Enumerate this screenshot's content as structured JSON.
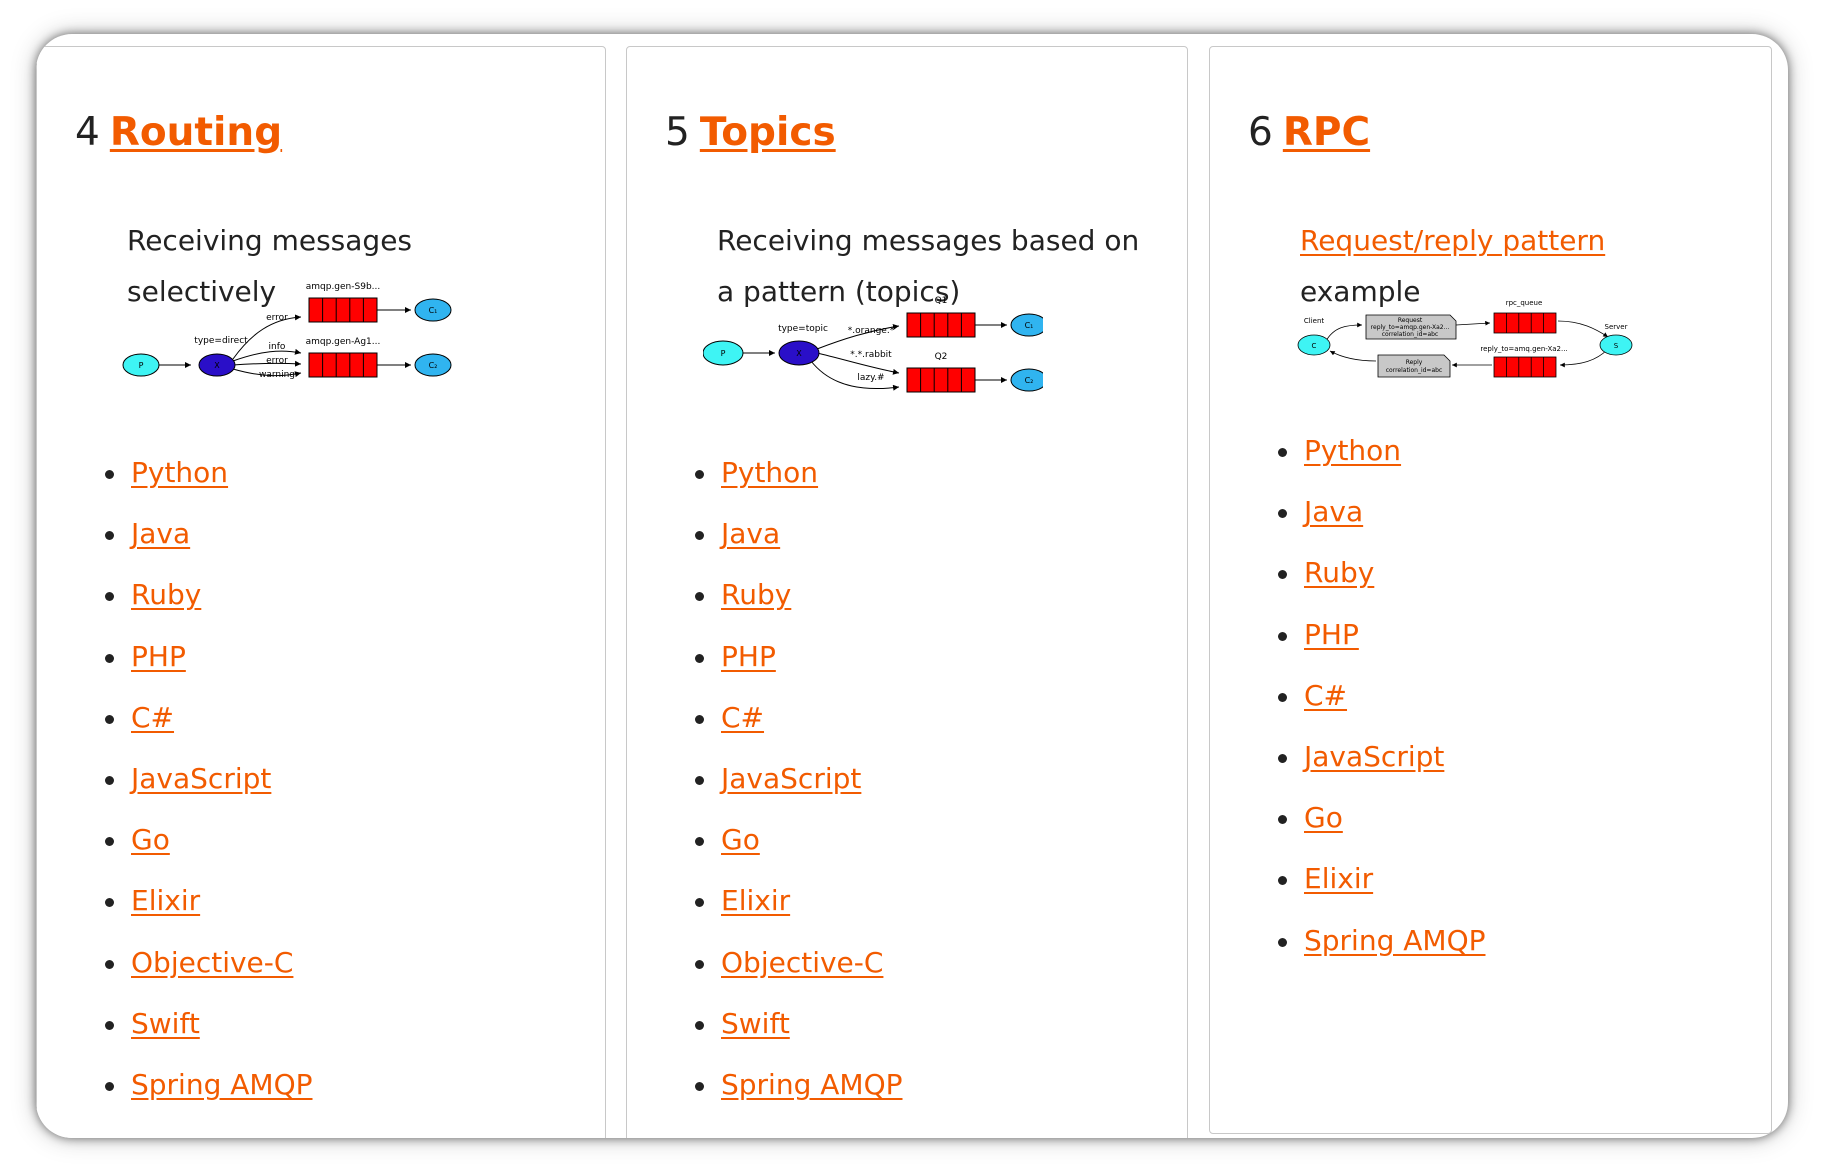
{
  "cards": [
    {
      "number": "4",
      "title": "Routing",
      "description": "Receiving messages selectively",
      "diagram": {
        "producer": "P",
        "exchange": "X",
        "exchange_type": "type=direct",
        "queue1": "amqp.gen-S9b...",
        "queue2": "amqp.gen-Ag1...",
        "binding_error1": "error",
        "binding_info": "info",
        "binding_error2": "error",
        "binding_warning": "warning",
        "consumer1": "C₁",
        "consumer2": "C₂"
      },
      "links": [
        "Python",
        "Java",
        "Ruby",
        "PHP",
        "C#",
        "JavaScript",
        "Go",
        "Elixir",
        "Objective-C",
        "Swift",
        "Spring AMQP"
      ]
    },
    {
      "number": "5",
      "title": "Topics",
      "description": "Receiving messages based on a pattern (topics)",
      "diagram": {
        "producer": "P",
        "exchange": "X",
        "exchange_type": "type=topic",
        "queue1": "Q1",
        "queue2": "Q2",
        "binding_orange": "*.orange.*",
        "binding_rabbit": "*.*.rabbit",
        "binding_lazy": "lazy.#",
        "consumer1": "C₁",
        "consumer2": "C₂"
      },
      "links": [
        "Python",
        "Java",
        "Ruby",
        "PHP",
        "C#",
        "JavaScript",
        "Go",
        "Elixir",
        "Objective-C",
        "Swift",
        "Spring AMQP"
      ]
    },
    {
      "number": "6",
      "title": "RPC",
      "description_link": "Request/reply pattern",
      "description_suffix": "example",
      "diagram": {
        "client_label": "Client",
        "client": "C",
        "server_label": "Server",
        "server": "S",
        "rpc_queue": "rpc_queue",
        "reply_queue": "reply_to=amq.gen-Xa2...",
        "request_title": "Request",
        "request_line1": "reply_to=amqp.gen-Xa2...",
        "request_line2": "correlation_id=abc",
        "reply_title": "Reply",
        "reply_line1": "correlation_id=abc"
      },
      "links": [
        "Python",
        "Java",
        "Ruby",
        "PHP",
        "C#",
        "JavaScript",
        "Go",
        "Elixir",
        "Spring AMQP"
      ]
    }
  ],
  "colors": {
    "accent": "#f25b00",
    "queue_fill": "#ff0000",
    "exchange_fill": "#2a0fc8",
    "producer_fill": "#3ef4f4",
    "consumer_fill": "#30b4f0",
    "message_fill": "#c8c8c8"
  }
}
